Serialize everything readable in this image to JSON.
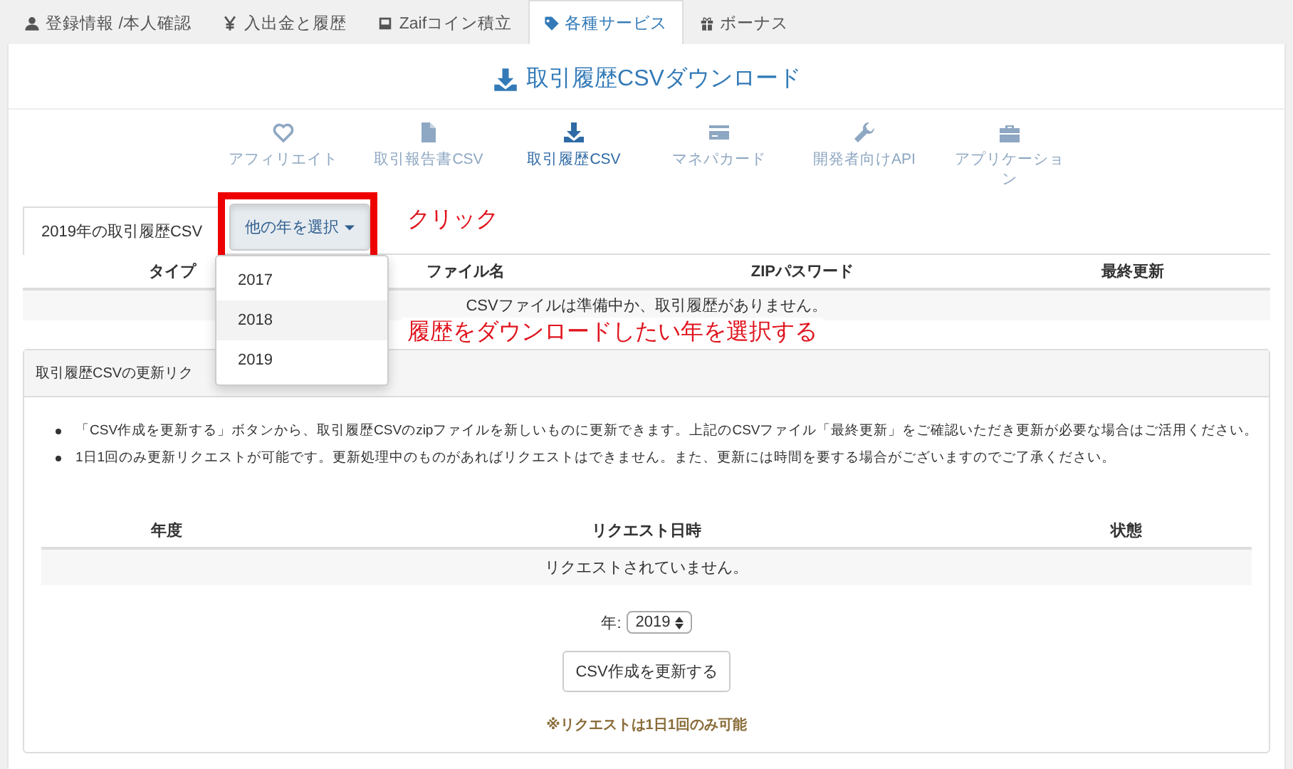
{
  "tabs": [
    {
      "label": "登録情報 /本人確認",
      "selected": false
    },
    {
      "label": "入出金と履歴",
      "selected": false
    },
    {
      "label": "Zaifコイン積立",
      "selected": false
    },
    {
      "label": "各種サービス",
      "selected": true
    },
    {
      "label": "ボーナス",
      "selected": false
    }
  ],
  "page_title": "取引履歴CSVダウンロード",
  "service_nav": [
    {
      "label": "アフィリエイト",
      "selected": false
    },
    {
      "label": "取引報告書CSV",
      "selected": false
    },
    {
      "label": "取引履歴CSV",
      "selected": true
    },
    {
      "label": "マネパカード",
      "selected": false
    },
    {
      "label": "開発者向けAPI",
      "selected": false
    },
    {
      "label": "アプリケーション",
      "selected": false
    }
  ],
  "csv_tab": {
    "label": "2019年の取引履歴CSV"
  },
  "year_dropdown": {
    "label": "他の年を選択",
    "expanded": true,
    "options": [
      {
        "label": "2017",
        "highlighted": false
      },
      {
        "label": "2018",
        "highlighted": true
      },
      {
        "label": "2019",
        "highlighted": false
      }
    ]
  },
  "csv_table": {
    "columns": [
      "タイプ",
      "ファイル名",
      "ZIPパスワード",
      "最終更新"
    ],
    "empty_message": "CSVファイルは準備中か、取引履歴がありません。"
  },
  "annotations": [
    {
      "kind": "click",
      "text": "クリック"
    },
    {
      "kind": "select",
      "text": "履歴をダウンロードしたい年を選択する"
    }
  ],
  "update_panel": {
    "title": "取引履歴CSVの更新リク",
    "notes": [
      "「CSV作成を更新する」ボタンから、取引履歴CSVのzipファイルを新しいものに更新できます。上記のCSVファイル「最終更新」をご確認いただき更新が必要な場合はご活用ください。",
      "1日1回のみ更新リクエストが可能です。更新処理中のものがあればリクエストはできません。また、更新には時間を要する場合がございますのでご了承ください。"
    ],
    "columns": [
      "年度",
      "リクエスト日時",
      "状態"
    ],
    "empty_message": "リクエストされていません。",
    "year_label": "年:",
    "year_value": "2019",
    "button": "CSV作成を更新する",
    "note": "※リクエストは1日1回のみ可能"
  }
}
